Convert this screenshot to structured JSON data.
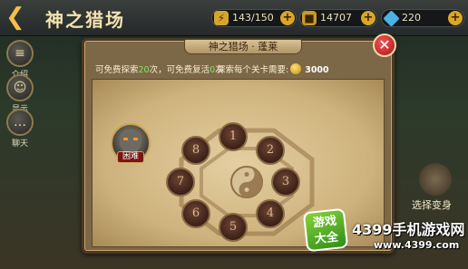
{
  "header": {
    "back_icon": "back-arrow-icon",
    "title": "神之猎场"
  },
  "resources": [
    {
      "name": "stamina",
      "icon": "lightning-icon",
      "value": "143/150"
    },
    {
      "name": "gold",
      "icon": "coin-stack-icon",
      "value": "14707"
    },
    {
      "name": "diamond",
      "icon": "diamond-icon",
      "value": "220"
    }
  ],
  "sidebar": {
    "items": [
      {
        "label": "介绍",
        "icon": "book-icon"
      },
      {
        "label": "显示",
        "icon": "person-icon"
      },
      {
        "label": "聊天",
        "icon": "speech-bubble-icon"
      }
    ]
  },
  "background": {
    "transform_label": "选择变身"
  },
  "dialog": {
    "tab_title": "神之猎场 · 蓬莱",
    "close_icon": "close-icon",
    "free_explore_prefix": "可免费探索",
    "free_explore_count": "20",
    "free_explore_suffix": "次，可免费复活",
    "free_revive_count": "0",
    "free_revive_suffix": "次",
    "cost_label": "探索每个关卡需要:",
    "cost_value": "3000",
    "boss": {
      "difficulty": "困难"
    },
    "nodes": [
      "1",
      "2",
      "3",
      "4",
      "5",
      "6",
      "7",
      "8"
    ]
  },
  "watermark": {
    "badge_line1": "游戏",
    "badge_line2": "大全",
    "text": "4399手机游戏网",
    "url": "www.4399.com"
  },
  "colors": {
    "accent_gold": "#d9a628",
    "close_red": "#c8202a",
    "count_green": "#7fe86a",
    "parchment": "#d9c392"
  }
}
